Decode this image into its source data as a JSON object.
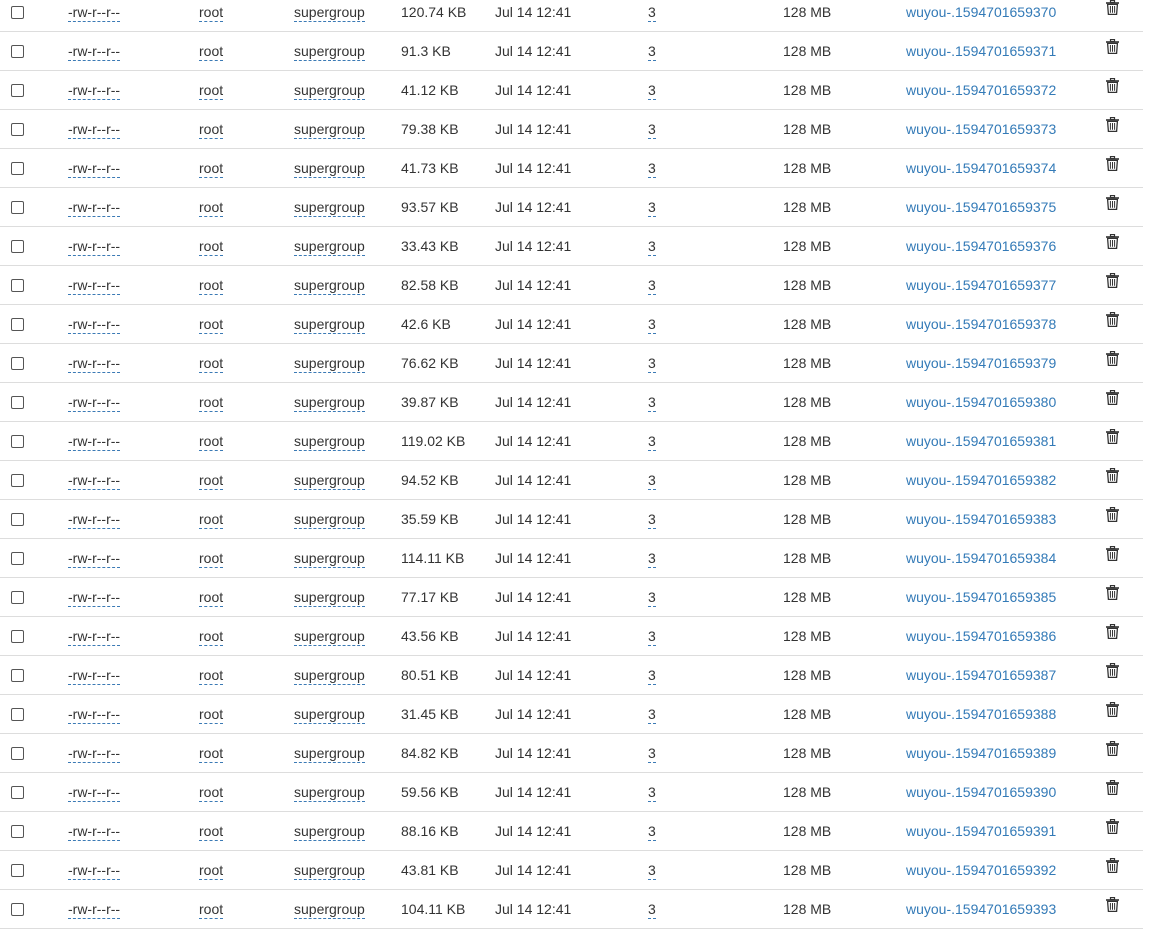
{
  "rows": [
    {
      "permission": "-rw-r--r--",
      "owner": "root",
      "group": "supergroup",
      "size": "120.74 KB",
      "modified": "Jul 14 12:41",
      "replication": "3",
      "block_size": "128 MB",
      "name": "wuyou-.1594701659370"
    },
    {
      "permission": "-rw-r--r--",
      "owner": "root",
      "group": "supergroup",
      "size": "91.3 KB",
      "modified": "Jul 14 12:41",
      "replication": "3",
      "block_size": "128 MB",
      "name": "wuyou-.1594701659371"
    },
    {
      "permission": "-rw-r--r--",
      "owner": "root",
      "group": "supergroup",
      "size": "41.12 KB",
      "modified": "Jul 14 12:41",
      "replication": "3",
      "block_size": "128 MB",
      "name": "wuyou-.1594701659372"
    },
    {
      "permission": "-rw-r--r--",
      "owner": "root",
      "group": "supergroup",
      "size": "79.38 KB",
      "modified": "Jul 14 12:41",
      "replication": "3",
      "block_size": "128 MB",
      "name": "wuyou-.1594701659373"
    },
    {
      "permission": "-rw-r--r--",
      "owner": "root",
      "group": "supergroup",
      "size": "41.73 KB",
      "modified": "Jul 14 12:41",
      "replication": "3",
      "block_size": "128 MB",
      "name": "wuyou-.1594701659374"
    },
    {
      "permission": "-rw-r--r--",
      "owner": "root",
      "group": "supergroup",
      "size": "93.57 KB",
      "modified": "Jul 14 12:41",
      "replication": "3",
      "block_size": "128 MB",
      "name": "wuyou-.1594701659375"
    },
    {
      "permission": "-rw-r--r--",
      "owner": "root",
      "group": "supergroup",
      "size": "33.43 KB",
      "modified": "Jul 14 12:41",
      "replication": "3",
      "block_size": "128 MB",
      "name": "wuyou-.1594701659376"
    },
    {
      "permission": "-rw-r--r--",
      "owner": "root",
      "group": "supergroup",
      "size": "82.58 KB",
      "modified": "Jul 14 12:41",
      "replication": "3",
      "block_size": "128 MB",
      "name": "wuyou-.1594701659377"
    },
    {
      "permission": "-rw-r--r--",
      "owner": "root",
      "group": "supergroup",
      "size": "42.6 KB",
      "modified": "Jul 14 12:41",
      "replication": "3",
      "block_size": "128 MB",
      "name": "wuyou-.1594701659378"
    },
    {
      "permission": "-rw-r--r--",
      "owner": "root",
      "group": "supergroup",
      "size": "76.62 KB",
      "modified": "Jul 14 12:41",
      "replication": "3",
      "block_size": "128 MB",
      "name": "wuyou-.1594701659379"
    },
    {
      "permission": "-rw-r--r--",
      "owner": "root",
      "group": "supergroup",
      "size": "39.87 KB",
      "modified": "Jul 14 12:41",
      "replication": "3",
      "block_size": "128 MB",
      "name": "wuyou-.1594701659380"
    },
    {
      "permission": "-rw-r--r--",
      "owner": "root",
      "group": "supergroup",
      "size": "119.02 KB",
      "modified": "Jul 14 12:41",
      "replication": "3",
      "block_size": "128 MB",
      "name": "wuyou-.1594701659381"
    },
    {
      "permission": "-rw-r--r--",
      "owner": "root",
      "group": "supergroup",
      "size": "94.52 KB",
      "modified": "Jul 14 12:41",
      "replication": "3",
      "block_size": "128 MB",
      "name": "wuyou-.1594701659382"
    },
    {
      "permission": "-rw-r--r--",
      "owner": "root",
      "group": "supergroup",
      "size": "35.59 KB",
      "modified": "Jul 14 12:41",
      "replication": "3",
      "block_size": "128 MB",
      "name": "wuyou-.1594701659383"
    },
    {
      "permission": "-rw-r--r--",
      "owner": "root",
      "group": "supergroup",
      "size": "114.11 KB",
      "modified": "Jul 14 12:41",
      "replication": "3",
      "block_size": "128 MB",
      "name": "wuyou-.1594701659384"
    },
    {
      "permission": "-rw-r--r--",
      "owner": "root",
      "group": "supergroup",
      "size": "77.17 KB",
      "modified": "Jul 14 12:41",
      "replication": "3",
      "block_size": "128 MB",
      "name": "wuyou-.1594701659385"
    },
    {
      "permission": "-rw-r--r--",
      "owner": "root",
      "group": "supergroup",
      "size": "43.56 KB",
      "modified": "Jul 14 12:41",
      "replication": "3",
      "block_size": "128 MB",
      "name": "wuyou-.1594701659386"
    },
    {
      "permission": "-rw-r--r--",
      "owner": "root",
      "group": "supergroup",
      "size": "80.51 KB",
      "modified": "Jul 14 12:41",
      "replication": "3",
      "block_size": "128 MB",
      "name": "wuyou-.1594701659387"
    },
    {
      "permission": "-rw-r--r--",
      "owner": "root",
      "group": "supergroup",
      "size": "31.45 KB",
      "modified": "Jul 14 12:41",
      "replication": "3",
      "block_size": "128 MB",
      "name": "wuyou-.1594701659388"
    },
    {
      "permission": "-rw-r--r--",
      "owner": "root",
      "group": "supergroup",
      "size": "84.82 KB",
      "modified": "Jul 14 12:41",
      "replication": "3",
      "block_size": "128 MB",
      "name": "wuyou-.1594701659389"
    },
    {
      "permission": "-rw-r--r--",
      "owner": "root",
      "group": "supergroup",
      "size": "59.56 KB",
      "modified": "Jul 14 12:41",
      "replication": "3",
      "block_size": "128 MB",
      "name": "wuyou-.1594701659390"
    },
    {
      "permission": "-rw-r--r--",
      "owner": "root",
      "group": "supergroup",
      "size": "88.16 KB",
      "modified": "Jul 14 12:41",
      "replication": "3",
      "block_size": "128 MB",
      "name": "wuyou-.1594701659391"
    },
    {
      "permission": "-rw-r--r--",
      "owner": "root",
      "group": "supergroup",
      "size": "43.81 KB",
      "modified": "Jul 14 12:41",
      "replication": "3",
      "block_size": "128 MB",
      "name": "wuyou-.1594701659392"
    },
    {
      "permission": "-rw-r--r--",
      "owner": "root",
      "group": "supergroup",
      "size": "104.11 KB",
      "modified": "Jul 14 12:41",
      "replication": "3",
      "block_size": "128 MB",
      "name": "wuyou-.1594701659393"
    }
  ],
  "icons": {
    "select": "checkbox-icon",
    "delete": "trash-icon"
  },
  "colors": {
    "link": "#337ab7",
    "text": "#333333",
    "row_border": "#dddddd"
  }
}
